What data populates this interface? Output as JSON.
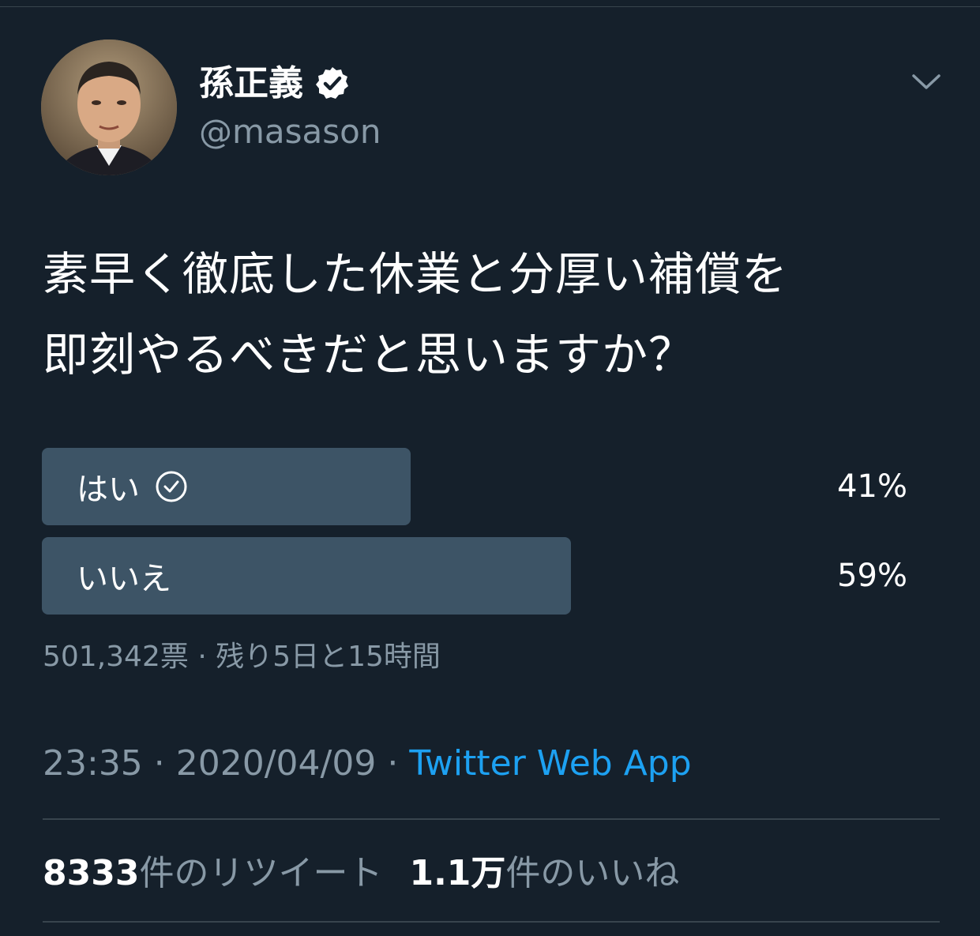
{
  "author": {
    "display_name": "孫正義",
    "handle": "@masason",
    "verified_icon": "verified-badge-icon"
  },
  "tweet": {
    "text": "素早く徹底した休業と分厚い補償を\n即刻やるべきだと思いますか？"
  },
  "poll": {
    "options": [
      {
        "label": "はい",
        "percent_label": "41%",
        "percent": 41,
        "selected": true
      },
      {
        "label": "いいえ",
        "percent_label": "59%",
        "percent": 59,
        "selected": false
      }
    ],
    "meta": "501,342票 · 残り5日と15時間"
  },
  "timestamp": {
    "time_date": "23:35 · 2020/04/09 · ",
    "source": "Twitter Web App"
  },
  "stats": {
    "retweets_count": "8333",
    "retweets_label": "件のリツイート",
    "likes_count": "1.1万",
    "likes_label": "件のいいね"
  },
  "colors": {
    "background": "#15202b",
    "poll_bar": "#3d5466",
    "secondary_text": "#8899a6",
    "link": "#1da1f2"
  }
}
